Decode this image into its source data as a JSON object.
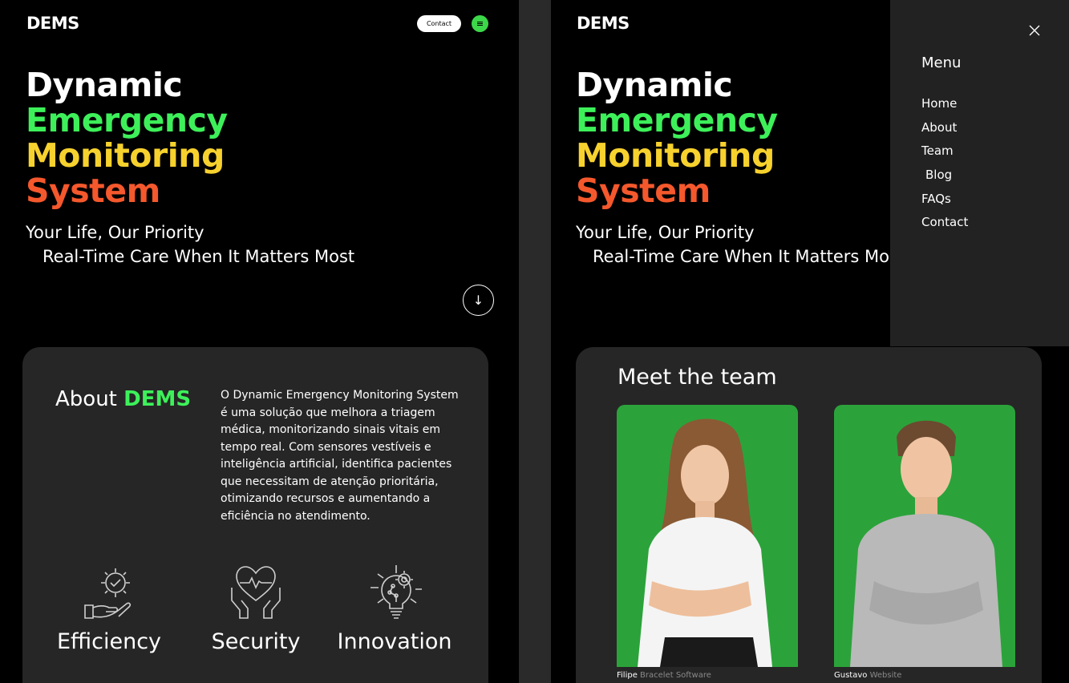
{
  "brand": "DEMS",
  "header": {
    "contact_label": "Contact"
  },
  "hero": {
    "line1": "Dynamic",
    "line2": "Emergency",
    "line3": "Monitoring",
    "line4": "System",
    "tagline1": "Your Life, Our Priority",
    "tagline2": "Real-Time Care When It Matters Most"
  },
  "about": {
    "title_prefix": "About",
    "title_brand": "DEMS",
    "text": "O Dynamic Emergency Monitoring System é uma solução que melhora a triagem médica, monitorizando sinais vitais em tempo real. Com sensores vestíveis e inteligência artificial, identifica pacientes que necessitam de atenção prioritária, otimizando recursos e aumentando a eficiência no atendimento.",
    "features": [
      {
        "label": "Efficiency",
        "icon": "gear-hand-icon"
      },
      {
        "label": "Security",
        "icon": "heart-hands-icon"
      },
      {
        "label": "Innovation",
        "icon": "lightbulb-gear-icon"
      }
    ]
  },
  "team": {
    "title": "Meet the team",
    "members": [
      {
        "name": "Filipe",
        "role": "Bracelet Software"
      },
      {
        "name": "Gustavo",
        "role": "Website"
      }
    ]
  },
  "menu": {
    "heading": "Menu",
    "items": [
      "Home",
      "About",
      "Team",
      "Blog",
      "FAQs",
      "Contact"
    ]
  },
  "colors": {
    "green": "#3df05a",
    "yellow": "#f7d12d",
    "orange": "#f4582c",
    "photo_bg": "#2ba33a",
    "card_bg": "#262626"
  }
}
